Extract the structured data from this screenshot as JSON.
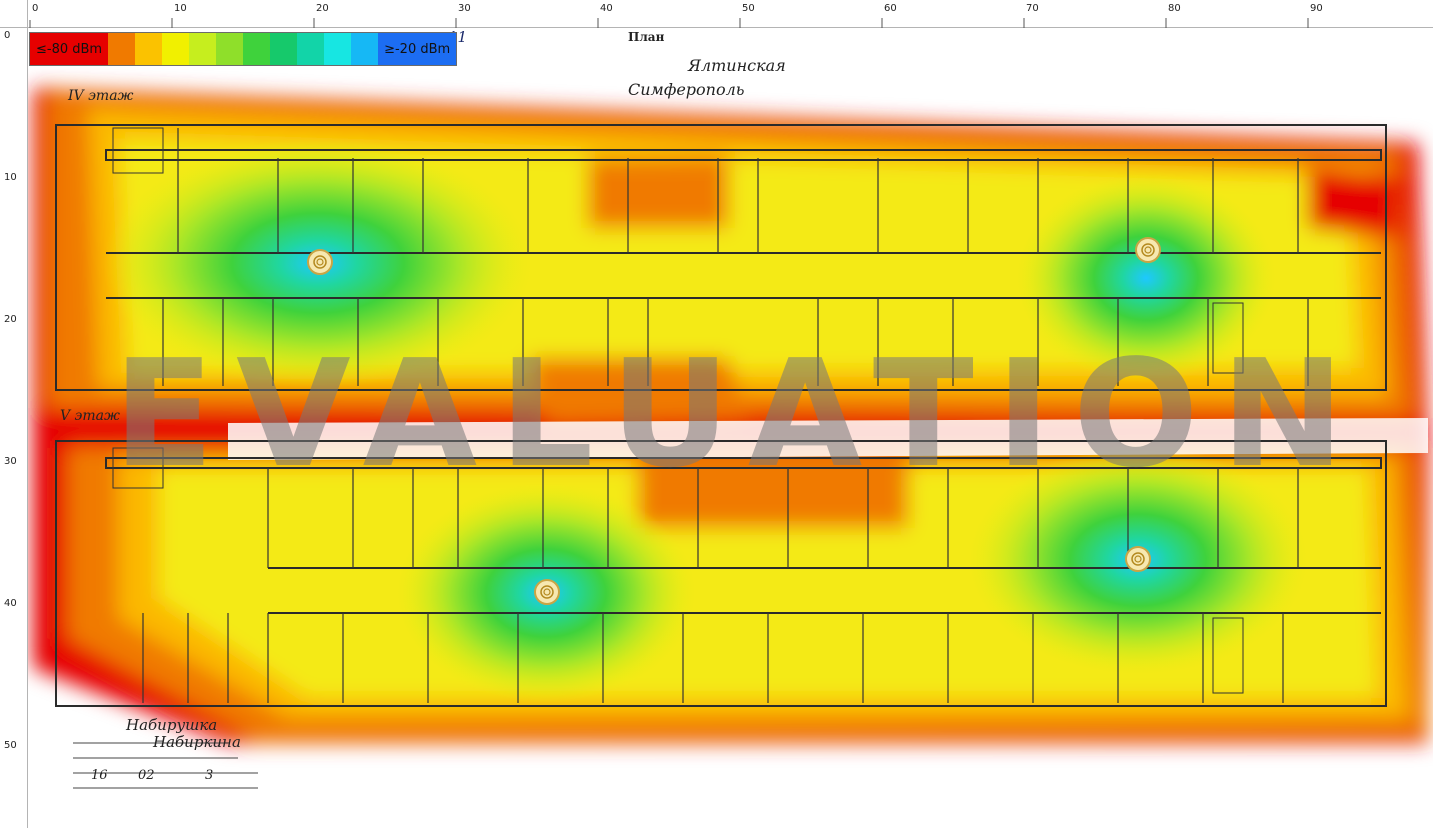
{
  "ruler": {
    "top_ticks": [
      "0",
      "10",
      "20",
      "30",
      "40",
      "50",
      "60",
      "70",
      "80",
      "90"
    ],
    "left_ticks": [
      "0",
      "10",
      "20",
      "30",
      "40",
      "50"
    ]
  },
  "legend": {
    "min_label": "≤-80 dBm",
    "max_label": "≥-20 dBm",
    "colors": [
      "#e60000",
      "#f07a00",
      "#fbc200",
      "#f1f000",
      "#c6ee1e",
      "#8fdf2a",
      "#3fd23c",
      "#16c96b",
      "#12d4a8",
      "#17e6e2",
      "#16b8f5",
      "#1c6df2"
    ]
  },
  "plan_header": {
    "line1": "План",
    "line2": "Ялтинская",
    "line3": "Симферополь",
    "sheet": "11"
  },
  "floors": {
    "floor4": "IV этаж",
    "floor5": "V этаж"
  },
  "footer": {
    "sign1": "Набирушка",
    "sign2": "Набиркина",
    "n1": "16",
    "n2": "02",
    "n3": "3"
  },
  "watermark": "EVALUATION",
  "access_points": [
    "ap-icon",
    "ap-icon",
    "ap-icon",
    "ap-icon"
  ]
}
